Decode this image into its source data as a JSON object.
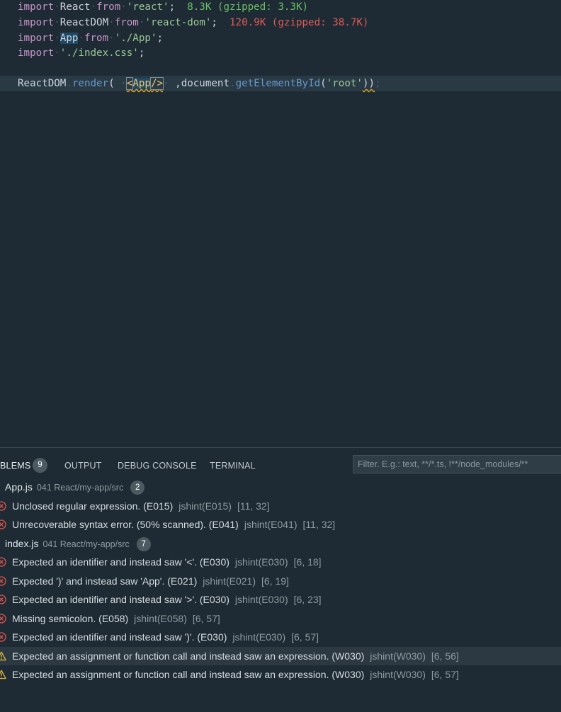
{
  "editor": {
    "lines": [
      {
        "kind": "import",
        "kw": "import",
        "name": "React",
        "from": "from",
        "mod": "'react'",
        "semi": ";",
        "size": "8.3K (gzipped: 3.3K)",
        "size_color": "green"
      },
      {
        "kind": "import",
        "kw": "import",
        "name": "ReactDOM",
        "from": "from",
        "mod": "'react-dom'",
        "semi": ";",
        "size": "120.9K (gzipped: 38.7K)",
        "size_color": "red"
      },
      {
        "kind": "import",
        "kw": "import",
        "name": "App",
        "from": "from",
        "mod": "'./App'",
        "semi": ";"
      },
      {
        "kind": "import-css",
        "kw": "import",
        "mod": "'./index.css'",
        "semi": ";"
      }
    ],
    "render_line": {
      "obj": "ReactDOM",
      "dot": ".",
      "method": "render",
      "open": "(",
      "tag_open": "<",
      "tag_name": "App",
      "tag_close": "/>",
      "comma": ",",
      "doc": "document",
      "dot2": ".",
      "get": "getElementById",
      "arg_open": "(",
      "arg": "'root'",
      "close": "))",
      "semi": ";"
    }
  },
  "panel": {
    "tabs": [
      {
        "label": "BLEMS",
        "active": true
      },
      {
        "label": "OUTPUT"
      },
      {
        "label": "DEBUG CONSOLE"
      },
      {
        "label": "TERMINAL"
      }
    ],
    "problems_count": "9",
    "filter_placeholder": "Filter. E.g.: text, **/*.ts, !**/node_modules/**",
    "rows": [
      {
        "type": "file",
        "name": "App.js",
        "path": "041 React/my-app/src",
        "count": "2"
      },
      {
        "type": "error",
        "msg": "Unclosed regular expression. (E015)",
        "src": "jshint(E015)",
        "loc": "[11, 32]"
      },
      {
        "type": "error",
        "msg": "Unrecoverable syntax error. (50% scanned). (E041)",
        "src": "jshint(E041)",
        "loc": "[11, 32]"
      },
      {
        "type": "file",
        "name": "index.js",
        "path": "041 React/my-app/src",
        "count": "7"
      },
      {
        "type": "error",
        "msg": "Expected an identifier and instead saw '<'. (E030)",
        "src": "jshint(E030)",
        "loc": "[6, 18]"
      },
      {
        "type": "error",
        "msg": "Expected ')' and instead saw 'App'. (E021)",
        "src": "jshint(E021)",
        "loc": "[6, 19]"
      },
      {
        "type": "error",
        "msg": "Expected an identifier and instead saw '>'. (E030)",
        "src": "jshint(E030)",
        "loc": "[6, 23]"
      },
      {
        "type": "error",
        "msg": "Missing semicolon. (E058)",
        "src": "jshint(E058)",
        "loc": "[6, 57]"
      },
      {
        "type": "error",
        "msg": "Expected an identifier and instead saw ')'. (E030)",
        "src": "jshint(E030)",
        "loc": "[6, 57]"
      },
      {
        "type": "warning",
        "msg": "Expected an assignment or function call and instead saw an expression. (W030)",
        "src": "jshint(W030)",
        "loc": "[6, 56]",
        "selected": true
      },
      {
        "type": "warning",
        "msg": "Expected an assignment or function call and instead saw an expression. (W030)",
        "src": "jshint(W030)",
        "loc": "[6, 57]"
      }
    ],
    "colors": {
      "error": "#e0554f",
      "warning": "#e2b93d"
    }
  }
}
